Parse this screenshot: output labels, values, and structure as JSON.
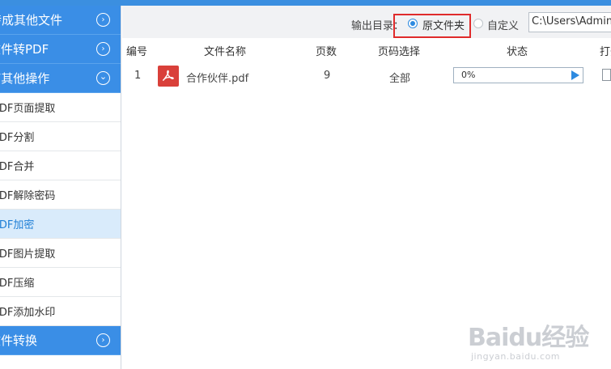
{
  "sidebar": {
    "items": [
      {
        "type": "category",
        "label": "转成其他文件",
        "icon": "chevron-right-circle-icon",
        "glyph": "›"
      },
      {
        "type": "category",
        "label": "文件转PDF",
        "icon": "chevron-right-circle-icon",
        "glyph": "›"
      },
      {
        "type": "category",
        "label": "PDF其他操作",
        "icon": "chevron-down-circle-icon",
        "glyph": "⌄"
      },
      {
        "type": "sub",
        "label": "PDF页面提取"
      },
      {
        "type": "sub",
        "label": "PDF分割"
      },
      {
        "type": "sub",
        "label": "PDF合并"
      },
      {
        "type": "sub",
        "label": "PDF解除密码"
      },
      {
        "type": "sub",
        "label": "PDF加密",
        "active": true
      },
      {
        "type": "sub",
        "label": "PDF图片提取"
      },
      {
        "type": "sub",
        "label": "PDF压缩"
      },
      {
        "type": "sub",
        "label": "PDF添加水印"
      },
      {
        "type": "category",
        "label": "文件转换",
        "icon": "chevron-right-circle-icon",
        "glyph": "›"
      }
    ]
  },
  "toolbar": {
    "output_label": "输出目录：",
    "option_original": "原文件夹",
    "option_custom": "自定义",
    "selected": "原文件夹",
    "path_value": "C:\\Users\\Administrator\\Desktop"
  },
  "table": {
    "headers": [
      "编号",
      "文件名称",
      "页数",
      "页码选择",
      "状态",
      "打开"
    ],
    "rows": [
      {
        "index": "1",
        "file_icon": "pdf-file-icon",
        "filename": "合作伙伴.pdf",
        "pages": "9",
        "page_selection": "全部",
        "progress_text": "0%",
        "progress": 0
      }
    ]
  },
  "watermark": {
    "main": "Baidu经验",
    "sub": "jingyan.baidu.com"
  },
  "colors": {
    "accent": "#3a8ee6",
    "active_bg": "#d9ebfb",
    "highlight_box": "#e02b2b",
    "pdf_icon": "#d9403a"
  }
}
